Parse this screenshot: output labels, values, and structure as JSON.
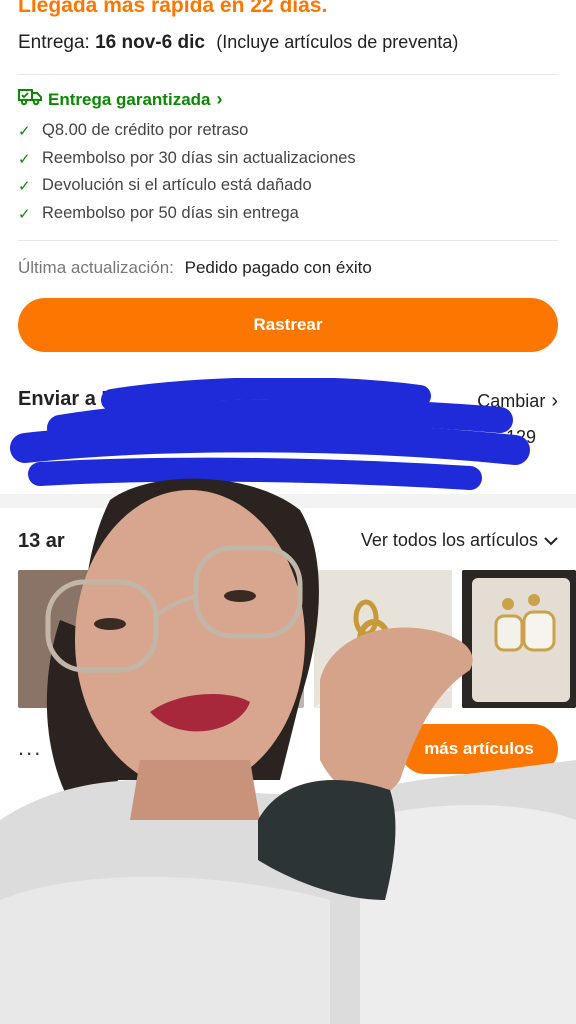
{
  "shipping": {
    "headline": "Llegada más rápida en 22 días.",
    "delivery_label": "Entrega:",
    "delivery_dates": "16 nov-6 dic",
    "delivery_note": "(Incluye artículos de preventa)"
  },
  "guarantee": {
    "title": "Entrega garantizada",
    "perks": [
      "Q8.00 de crédito por retraso",
      "Reembolso por 30 días sin actualizaciones",
      "Devolución si el artículo está dañado",
      "Reembolso por 50 días sin entrega"
    ]
  },
  "status": {
    "label": "Última actualización:",
    "value": "Pedido pagado con éxito"
  },
  "track_button": "Rastrear",
  "address": {
    "title": "Enviar a E",
    "change_label": "Cambiar",
    "partial_number": "129"
  },
  "items": {
    "count_label": "13 ar",
    "view_all_label": "Ver todos los artículos",
    "more_button": "más artículos",
    "dots": "..."
  },
  "colors": {
    "accent": "#fb7701",
    "success": "#0a8a00",
    "redaction": "#1f2bd9"
  },
  "icons": [
    "truck-icon",
    "chevron-right-icon",
    "check-icon",
    "chevron-down-icon"
  ]
}
